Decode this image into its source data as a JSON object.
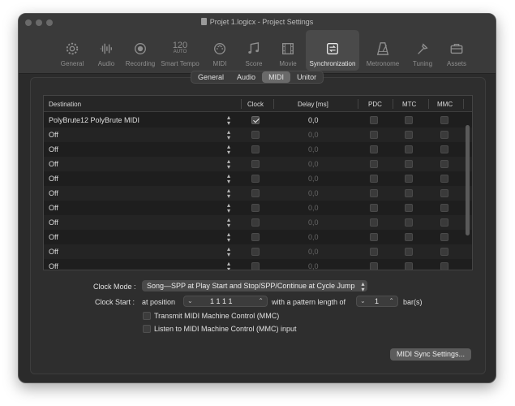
{
  "window": {
    "title": "Projet 1.logicx - Project Settings"
  },
  "toolbar": {
    "items": [
      {
        "label": "General",
        "icon": "gear-icon"
      },
      {
        "label": "Audio",
        "icon": "waveform-icon"
      },
      {
        "label": "Recording",
        "icon": "record-icon"
      },
      {
        "label": "Smart Tempo",
        "icon": "smart-tempo-icon",
        "icon_text": "120",
        "icon_sub": "AUTO"
      },
      {
        "label": "MIDI",
        "icon": "midi-port-icon"
      },
      {
        "label": "Score",
        "icon": "notes-icon"
      },
      {
        "label": "Movie",
        "icon": "film-icon"
      },
      {
        "label": "Synchronization",
        "icon": "sync-icon",
        "selected": true
      },
      {
        "label": "Metronome",
        "icon": "metronome-icon"
      },
      {
        "label": "Tuning",
        "icon": "tuning-icon"
      },
      {
        "label": "Assets",
        "icon": "briefcase-icon"
      }
    ]
  },
  "tabs": {
    "general": "General",
    "audio": "Audio",
    "midi": "MIDI",
    "unitor": "Unitor",
    "active": "MIDI"
  },
  "table": {
    "columns": {
      "destination": "Destination",
      "clock": "Clock",
      "delay": "Delay [ms]",
      "pdc": "PDC",
      "mtc": "MTC",
      "mmc": "MMC"
    },
    "rows": [
      {
        "destination": "PolyBrute12 PolyBrute MIDI",
        "clock": true,
        "delay": "0,0",
        "pdc": false,
        "mtc": false,
        "mmc": false,
        "enabled": true
      },
      {
        "destination": "Off",
        "clock": false,
        "delay": "0,0",
        "pdc": false,
        "mtc": false,
        "mmc": false,
        "enabled": false
      },
      {
        "destination": "Off",
        "clock": false,
        "delay": "0,0",
        "pdc": false,
        "mtc": false,
        "mmc": false,
        "enabled": false
      },
      {
        "destination": "Off",
        "clock": false,
        "delay": "0,0",
        "pdc": false,
        "mtc": false,
        "mmc": false,
        "enabled": false
      },
      {
        "destination": "Off",
        "clock": false,
        "delay": "0,0",
        "pdc": false,
        "mtc": false,
        "mmc": false,
        "enabled": false
      },
      {
        "destination": "Off",
        "clock": false,
        "delay": "0,0",
        "pdc": false,
        "mtc": false,
        "mmc": false,
        "enabled": false
      },
      {
        "destination": "Off",
        "clock": false,
        "delay": "0,0",
        "pdc": false,
        "mtc": false,
        "mmc": false,
        "enabled": false
      },
      {
        "destination": "Off",
        "clock": false,
        "delay": "0,0",
        "pdc": false,
        "mtc": false,
        "mmc": false,
        "enabled": false
      },
      {
        "destination": "Off",
        "clock": false,
        "delay": "0,0",
        "pdc": false,
        "mtc": false,
        "mmc": false,
        "enabled": false
      },
      {
        "destination": "Off",
        "clock": false,
        "delay": "0,0",
        "pdc": false,
        "mtc": false,
        "mmc": false,
        "enabled": false
      },
      {
        "destination": "Off",
        "clock": false,
        "delay": "0,0",
        "pdc": false,
        "mtc": false,
        "mmc": false,
        "enabled": false
      }
    ]
  },
  "clock": {
    "mode_label": "Clock Mode :",
    "mode_value": "Song—SPP at Play Start and Stop/SPP/Continue at Cycle Jump",
    "start_label": "Clock Start :",
    "at_position": "at position",
    "position_value": "1  1  1      1",
    "pattern_text": "with a pattern length of",
    "pattern_value": "1",
    "bars": "bar(s)"
  },
  "options": {
    "transmit_mmc": "Transmit MIDI Machine Control (MMC)",
    "listen_mmc": "Listen to MIDI Machine Control (MMC) input"
  },
  "buttons": {
    "sync_settings": "MIDI Sync Settings..."
  },
  "colors": {
    "window_bg": "#2b2b2b",
    "toolbar_bg": "#3a3a3a",
    "table_bg": "#1e1e1e",
    "selected": "#6a6a6a"
  }
}
